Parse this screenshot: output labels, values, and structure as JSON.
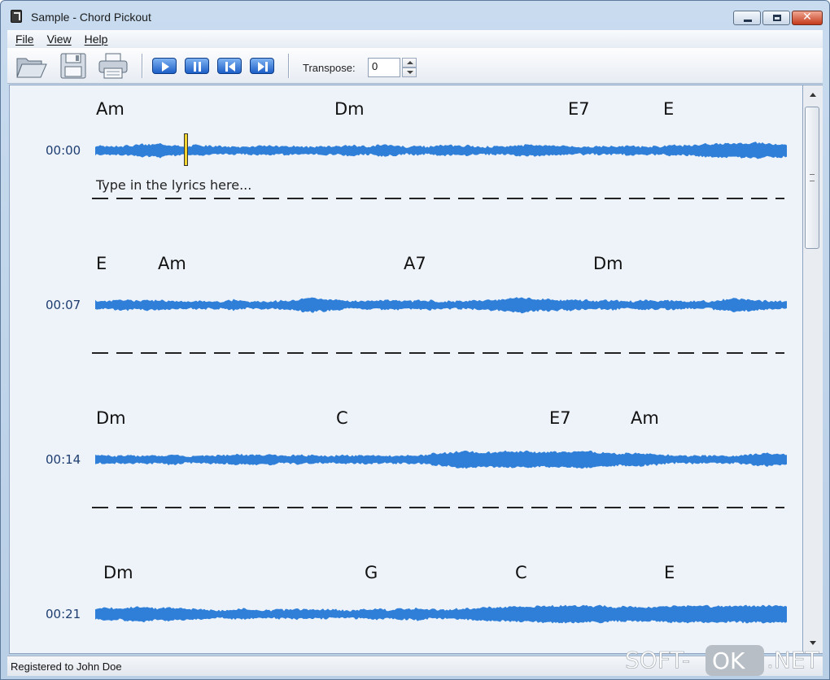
{
  "window": {
    "title": "Sample - Chord Pickout"
  },
  "menu": {
    "items": [
      "File",
      "View",
      "Help"
    ]
  },
  "toolbar": {
    "buttons": [
      "open-folder-icon",
      "save-icon",
      "print-icon",
      "play-icon",
      "pause-icon",
      "skip-back-icon",
      "skip-forward-icon"
    ],
    "transpose_label": "Transpose:",
    "transpose_value": "0"
  },
  "colors": {
    "waveform": "#2f7fd9",
    "cursor": "#f2d431",
    "content_bg": "#eef3fa",
    "time_text": "#1d3d70"
  },
  "sections": [
    {
      "time": "00:00",
      "chords": [
        "Am",
        "Dm",
        "E7",
        "E"
      ],
      "lyrics": "Type in the lyrics here..."
    },
    {
      "time": "00:07",
      "chords": [
        "E",
        "Am",
        "A7",
        "Dm"
      ],
      "lyrics": ""
    },
    {
      "time": "00:14",
      "chords": [
        "Dm",
        "C",
        "E7",
        "Am"
      ],
      "lyrics": ""
    },
    {
      "time": "00:21",
      "chords": [
        "Dm",
        "G",
        "C",
        "E"
      ],
      "lyrics": ""
    }
  ],
  "status": {
    "text": "Registered to John Doe"
  },
  "watermark": {
    "left": "SOFT-",
    "badge": "OK",
    "right": ".NET"
  }
}
